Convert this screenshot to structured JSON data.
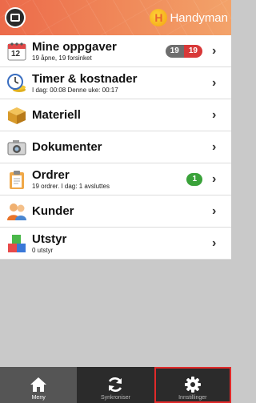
{
  "header": {
    "brand_text": "Handyman",
    "brand_initial": "H"
  },
  "menu": [
    {
      "icon": "calendar-icon",
      "title": "Mine oppgaver",
      "subtitle": "19 åpne, 19 forsinket",
      "badges": [
        "19",
        "19"
      ]
    },
    {
      "icon": "clock-coins-icon",
      "title": "Timer & kostnader",
      "subtitle": "I dag: 00:08 Denne uke: 00:17"
    },
    {
      "icon": "box-icon",
      "title": "Materiell",
      "subtitle": ""
    },
    {
      "icon": "camera-icon",
      "title": "Dokumenter",
      "subtitle": ""
    },
    {
      "icon": "clipboard-icon",
      "title": "Ordrer",
      "subtitle": "19 ordrer. I dag: 1 avsluttes",
      "badge_green": "1"
    },
    {
      "icon": "people-icon",
      "title": "Kunder",
      "subtitle": ""
    },
    {
      "icon": "cubes-icon",
      "title": "Utstyr",
      "subtitle": "0 utstyr"
    }
  ],
  "calendar_day": "12",
  "chevron": "›",
  "bottom_nav": {
    "menu_label": "Meny",
    "sync_label": "Synkroniser",
    "settings_label": "Innstillinger"
  },
  "colors": {
    "header": "#ec6a4a",
    "badge_grey": "#6e6e6e",
    "badge_red": "#d83838",
    "badge_green": "#3aa23a",
    "nav_bg": "#2b2b2b",
    "highlight": "#e12a2a"
  }
}
